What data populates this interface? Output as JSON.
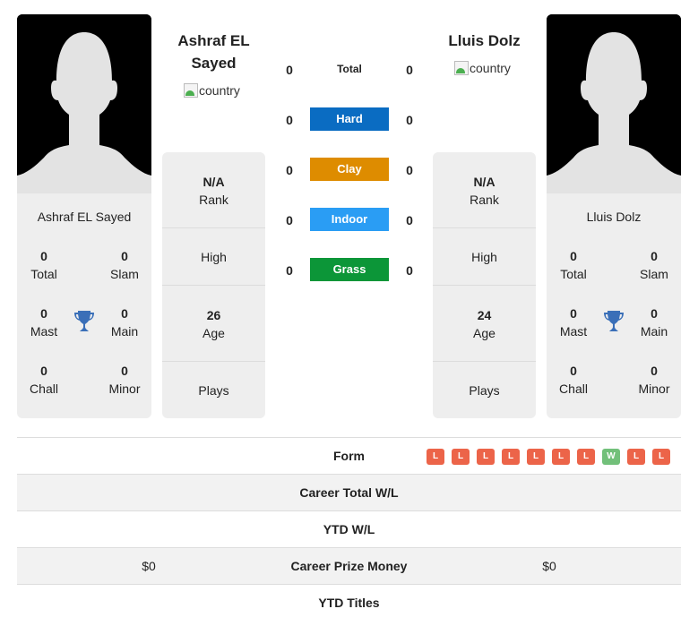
{
  "players": {
    "left": {
      "name": "Ashraf EL Sayed",
      "country_alt": "country",
      "card_name": "Ashraf EL Sayed",
      "stats": {
        "total": {
          "value": "0",
          "label": "Total"
        },
        "slam": {
          "value": "0",
          "label": "Slam"
        },
        "mast": {
          "value": "0",
          "label": "Mast"
        },
        "main": {
          "value": "0",
          "label": "Main"
        },
        "chall": {
          "value": "0",
          "label": "Chall"
        },
        "minor": {
          "value": "0",
          "label": "Minor"
        }
      },
      "info": {
        "rank": {
          "value": "N/A",
          "label": "Rank"
        },
        "high": {
          "value": "",
          "label": "High"
        },
        "age": {
          "value": "26",
          "label": "Age"
        },
        "plays": {
          "value": "",
          "label": "Plays"
        }
      }
    },
    "right": {
      "name": "Lluis Dolz",
      "country_alt": "country",
      "card_name": "Lluis Dolz",
      "stats": {
        "total": {
          "value": "0",
          "label": "Total"
        },
        "slam": {
          "value": "0",
          "label": "Slam"
        },
        "mast": {
          "value": "0",
          "label": "Mast"
        },
        "main": {
          "value": "0",
          "label": "Main"
        },
        "chall": {
          "value": "0",
          "label": "Chall"
        },
        "minor": {
          "value": "0",
          "label": "Minor"
        }
      },
      "info": {
        "rank": {
          "value": "N/A",
          "label": "Rank"
        },
        "high": {
          "value": "",
          "label": "High"
        },
        "age": {
          "value": "24",
          "label": "Age"
        },
        "plays": {
          "value": "",
          "label": "Plays"
        }
      }
    }
  },
  "surfaces": [
    {
      "label": "Total",
      "left": "0",
      "right": "0",
      "color": ""
    },
    {
      "label": "Hard",
      "left": "0",
      "right": "0",
      "color": "#0a6cc2"
    },
    {
      "label": "Clay",
      "left": "0",
      "right": "0",
      "color": "#de8c00"
    },
    {
      "label": "Indoor",
      "left": "0",
      "right": "0",
      "color": "#2a9df4"
    },
    {
      "label": "Grass",
      "left": "0",
      "right": "0",
      "color": "#0c9638"
    }
  ],
  "comparison": {
    "form": {
      "label": "Form",
      "results": [
        "L",
        "L",
        "L",
        "L",
        "L",
        "L",
        "L",
        "W",
        "L",
        "L"
      ],
      "colors": {
        "L": "#ec6449",
        "W": "#72c07a"
      }
    },
    "rows": [
      {
        "label": "Career Total W/L",
        "left": "",
        "right": ""
      },
      {
        "label": "YTD W/L",
        "left": "",
        "right": ""
      },
      {
        "label": "Career Prize Money",
        "left": "$0",
        "right": "$0"
      },
      {
        "label": "YTD Titles",
        "left": "",
        "right": ""
      }
    ]
  },
  "colors": {
    "trophy": "#3a6fb8",
    "card_bg": "#eeeeee"
  }
}
